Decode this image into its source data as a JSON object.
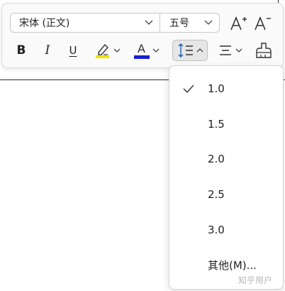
{
  "toolbar": {
    "font_name": "宋体 (正文)",
    "font_size": "五号",
    "bold_label": "B",
    "italic_label": "I",
    "underline_label": "U",
    "font_color_label": "A",
    "highlight_color": "#f4e000",
    "font_color": "#1a1fd0"
  },
  "line_spacing_menu": {
    "selected": "1.0",
    "items": [
      {
        "label": "1.0",
        "checked": true
      },
      {
        "label": "1.5",
        "checked": false
      },
      {
        "label": "2.0",
        "checked": false
      },
      {
        "label": "2.5",
        "checked": false
      },
      {
        "label": "3.0",
        "checked": false
      },
      {
        "label": "其他(M)...",
        "checked": false
      }
    ]
  },
  "watermark": "知乎用户"
}
